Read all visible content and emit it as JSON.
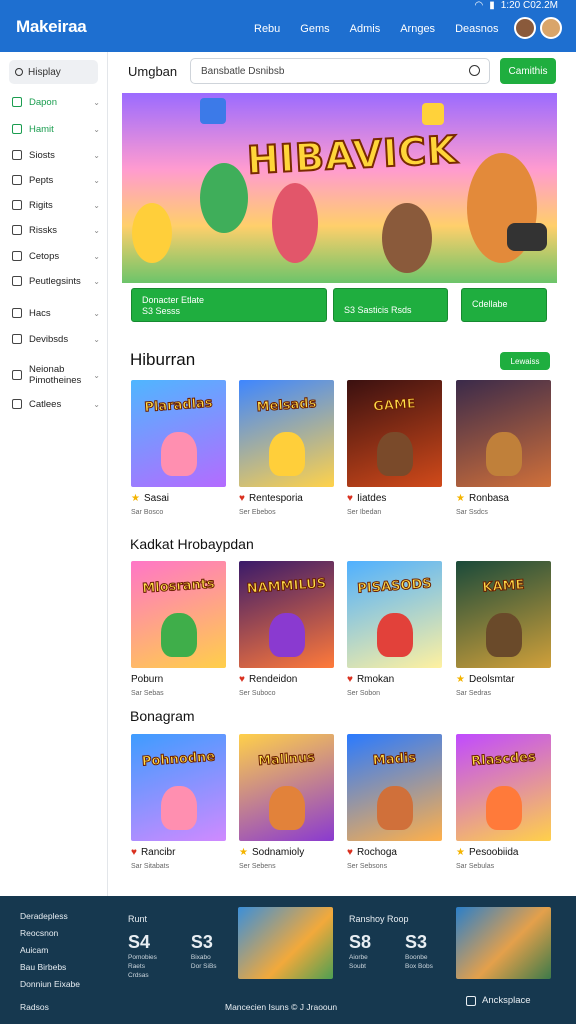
{
  "header": {
    "brand": "Makeiraa",
    "nav": [
      "Rebu",
      "Gems",
      "Admis",
      "Arnges",
      "Deasnos"
    ],
    "status_time": "1:20 C02.2M"
  },
  "sidebar": {
    "search_label": "Hisplay",
    "items": [
      {
        "label": "Dapon",
        "active": true
      },
      {
        "label": "Hamit",
        "active": true
      },
      {
        "label": "Siosts",
        "active": false
      },
      {
        "label": "Pepts",
        "active": false
      },
      {
        "label": "Rigits",
        "active": false
      },
      {
        "label": "Rissks",
        "active": false
      },
      {
        "label": "Cetops",
        "active": false
      },
      {
        "label": "Peutlegsints",
        "active": false
      },
      {
        "label": "Hacs",
        "active": false
      },
      {
        "label": "Devibsds",
        "active": false
      },
      {
        "label": "Neionab Pimotheines",
        "active": false
      },
      {
        "label": "Catlees",
        "active": false
      }
    ]
  },
  "toolbar": {
    "page_label": "Umgban",
    "search_value": "Bansbatle Dsnibsb",
    "cta_label": "Camithis"
  },
  "hero": {
    "title": "HIBAVICK",
    "buttons": [
      "Donacter Etlate\nS3 Sesss",
      "S3 Sasticis Rsds",
      "Cdellabe"
    ],
    "button_tag": "S"
  },
  "sections": [
    {
      "title": "Hiburran",
      "button": "Lewaiss",
      "cards": [
        {
          "thumb_title": "Plaradlas",
          "name": "Sasai",
          "sub": "Sar Bosco",
          "icon": "star-icon"
        },
        {
          "thumb_title": "Melsads",
          "name": "Rentesporia",
          "sub": "Ser Ebebos",
          "icon": "heart-icon"
        },
        {
          "thumb_title": "GAME",
          "name": "Iiatdes",
          "sub": "Ser Ibedan",
          "icon": "heart-icon"
        },
        {
          "thumb_title": "",
          "name": "Ronbasa",
          "sub": "Sar Ssdcs",
          "icon": "star-icon"
        }
      ]
    },
    {
      "title": "Kadkat Hrobaypdan",
      "cards": [
        {
          "thumb_title": "Mlosrants",
          "name": "Poburn",
          "sub": "Sar Sebas",
          "icon": ""
        },
        {
          "thumb_title": "NAMMILUS",
          "name": "Rendeidon",
          "sub": "Ser Suboco",
          "icon": "heart-icon"
        },
        {
          "thumb_title": "PISASODS",
          "name": "Rmokan",
          "sub": "Ser Sobon",
          "icon": "heart-icon"
        },
        {
          "thumb_title": "KAME",
          "name": "Deolsmtar",
          "sub": "Sar Sedras",
          "icon": "star-icon"
        }
      ]
    },
    {
      "title": "Bonagram",
      "cards": [
        {
          "thumb_title": "Pohnodne",
          "name": "Rancibr",
          "sub": "Sar Sitabats",
          "icon": "heart-icon"
        },
        {
          "thumb_title": "Mallnus",
          "name": "Sodnamioly",
          "sub": "Ser Sebens",
          "icon": "star-icon"
        },
        {
          "thumb_title": "Madis",
          "name": "Rochoga",
          "sub": "Ser Sebsons",
          "icon": "heart-icon"
        },
        {
          "thumb_title": "Rlascdes",
          "name": "Pesoobiida",
          "sub": "Sar Sebulas",
          "icon": "star-icon"
        }
      ]
    }
  ],
  "footer": {
    "links": [
      "Deradepless",
      "Reocsnon",
      "Auicam",
      "Bau Birbebs",
      "Donniun Eixabe",
      "Radsos"
    ],
    "block1": {
      "head": "Runt",
      "big1": "S4",
      "big2": "S3",
      "small1": "Pomobies\nRaets\nCrdsas",
      "small2": "Bixabo\nDor SiBs"
    },
    "block2": {
      "head": "Ranshoy Roop",
      "big1": "S8",
      "big2": "S3",
      "small1": "Aiorbe\nSoubt",
      "small2": "Boonbe\nBox Bobs"
    },
    "bottom_text": "Mancecien Isuns  © J Jraooun",
    "right_label": "Ancksplace"
  },
  "colors": {
    "topbar": "#1e6fd0",
    "accent_green": "#1fae3f",
    "footer_bg": "#16384f"
  }
}
